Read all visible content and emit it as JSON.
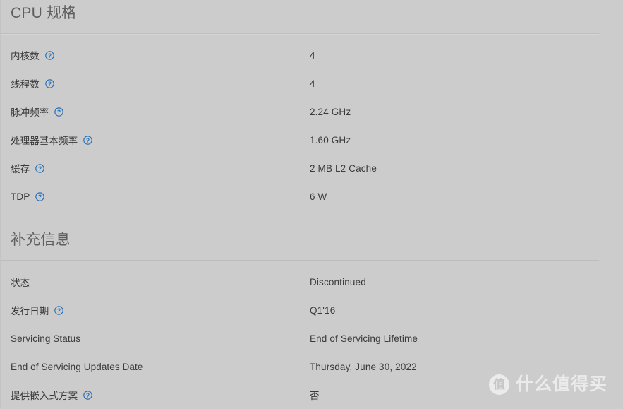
{
  "colors": {
    "background": "#cccccc",
    "heading_text": "#5f5f5f",
    "body_text": "#3a3a3a",
    "rule": "#bdbdbd",
    "help_icon": "#1e6bb8",
    "watermark": "#ffffff"
  },
  "sections": [
    {
      "title": "CPU 规格",
      "rows": [
        {
          "label": "内核数",
          "has_help": true,
          "value": "4"
        },
        {
          "label": "线程数",
          "has_help": true,
          "value": "4"
        },
        {
          "label": "脉冲频率",
          "has_help": true,
          "value": "2.24 GHz"
        },
        {
          "label": "处理器基本频率",
          "has_help": true,
          "value": "1.60 GHz"
        },
        {
          "label": "缓存",
          "has_help": true,
          "value": "2 MB L2 Cache"
        },
        {
          "label": "TDP",
          "has_help": true,
          "value": "6 W"
        }
      ]
    },
    {
      "title": "补充信息",
      "rows": [
        {
          "label": "状态",
          "has_help": false,
          "value": "Discontinued"
        },
        {
          "label": "发行日期",
          "has_help": true,
          "value": "Q1'16"
        },
        {
          "label": "Servicing Status",
          "has_help": false,
          "value": "End of Servicing Lifetime"
        },
        {
          "label": "End of Servicing Updates Date",
          "has_help": false,
          "value": "Thursday, June 30, 2022"
        },
        {
          "label": "提供嵌入式方案",
          "has_help": true,
          "value": "否"
        }
      ]
    }
  ],
  "watermark": {
    "badge": "值",
    "text": "什么值得买"
  },
  "icons": {
    "help": "help-circle-icon"
  }
}
